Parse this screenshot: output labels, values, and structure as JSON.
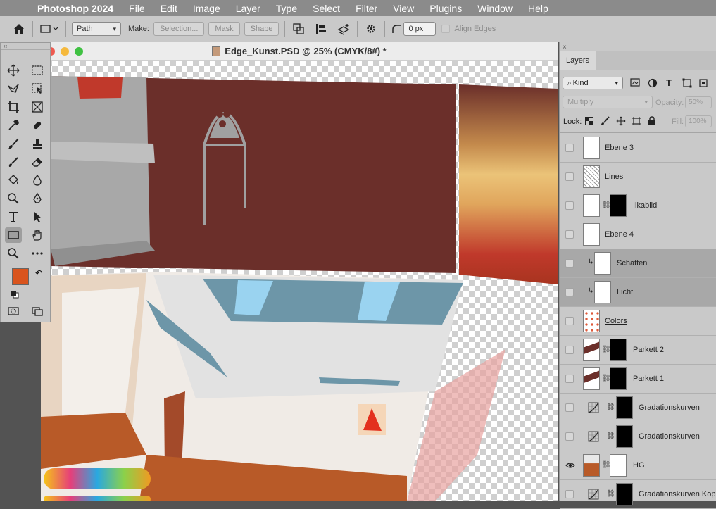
{
  "menubar": {
    "app_name": "Photoshop 2024",
    "items": [
      "File",
      "Edit",
      "Image",
      "Layer",
      "Type",
      "Select",
      "Filter",
      "View",
      "Plugins",
      "Window",
      "Help"
    ]
  },
  "options_bar": {
    "mode": "Path",
    "make_label": "Make:",
    "selection_btn": "Selection...",
    "mask_btn": "Mask",
    "shape_btn": "Shape",
    "radius_value": "0 px",
    "align_edges": "Align Edges"
  },
  "document": {
    "title": "Edge_Kunst.PSD @ 25% (CMYK/8#) *"
  },
  "colors": {
    "foreground": "#d9541d",
    "background": "#ffffff"
  },
  "layers_panel": {
    "tab": "Layers",
    "filter_kind": "Kind",
    "blend_mode": "Multiply",
    "opacity_label": "Opacity:",
    "opacity_value": "50%",
    "lock_label": "Lock:",
    "fill_label": "Fill:",
    "fill_value": "100%",
    "layers": [
      {
        "name": "Ebene 3",
        "visible": false
      },
      {
        "name": "Lines",
        "visible": false
      },
      {
        "name": "Ilkabild",
        "visible": false
      },
      {
        "name": "Ebene 4",
        "visible": false
      },
      {
        "name": "Schatten",
        "visible": false
      },
      {
        "name": "Licht",
        "visible": false
      },
      {
        "name": "Colors",
        "visible": false
      },
      {
        "name": "Parkett 2",
        "visible": false
      },
      {
        "name": "Parkett 1",
        "visible": false
      },
      {
        "name": "Gradationskurven",
        "visible": false
      },
      {
        "name": "Gradationskurven",
        "visible": false
      },
      {
        "name": "HG",
        "visible": true
      },
      {
        "name": "Gradationskurven Kopie",
        "visible": false
      }
    ]
  }
}
